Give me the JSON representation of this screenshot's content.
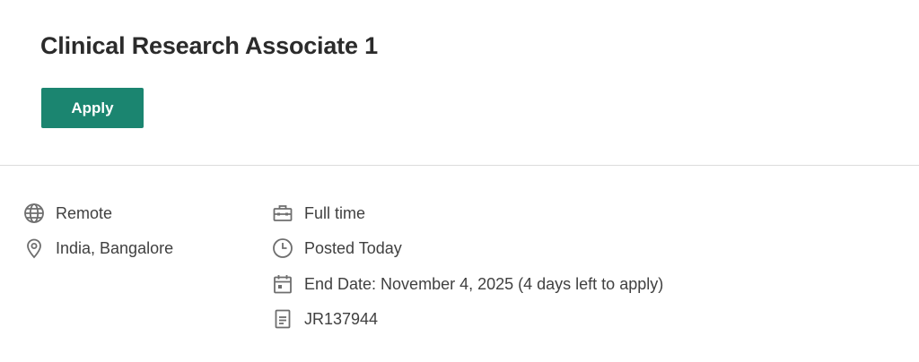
{
  "job": {
    "title": "Clinical Research Associate 1",
    "apply_label": "Apply"
  },
  "details": {
    "location_type": {
      "icon": "globe-icon",
      "text": "Remote"
    },
    "location": {
      "icon": "location-pin-icon",
      "text": "India, Bangalore"
    },
    "employment_type": {
      "icon": "briefcase-icon",
      "text": "Full time"
    },
    "posted": {
      "icon": "clock-icon",
      "text": "Posted Today"
    },
    "end_date": {
      "icon": "calendar-icon",
      "text": "End Date: November 4, 2025 (4 days left to apply)"
    },
    "job_id": {
      "icon": "document-icon",
      "text": "JR137944"
    }
  },
  "colors": {
    "accent": "#1b8570",
    "icon": "#6e6e6e",
    "divider": "#dcdcdc"
  }
}
